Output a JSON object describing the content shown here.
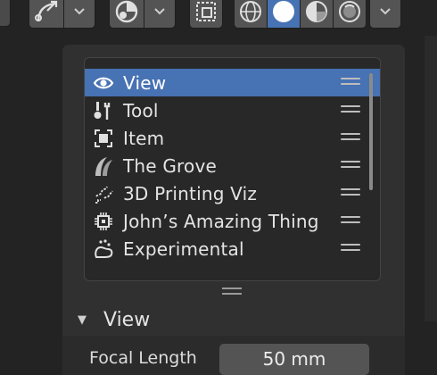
{
  "toolbar": {
    "buttons": [
      {
        "name": "curve-tool-icon"
      },
      {
        "name": "overlay-toggle-icon"
      },
      {
        "name": "xray-icon"
      },
      {
        "name": "wireframe-shading-icon"
      },
      {
        "name": "solid-shading-icon",
        "active": true
      },
      {
        "name": "material-preview-icon"
      },
      {
        "name": "rendered-shading-icon"
      }
    ]
  },
  "tabs_list": {
    "items": [
      {
        "label": "View",
        "icon": "eye-icon",
        "selected": true
      },
      {
        "label": "Tool",
        "icon": "tool-icon"
      },
      {
        "label": "Item",
        "icon": "item-icon"
      },
      {
        "label": "The Grove",
        "icon": "grove-icon"
      },
      {
        "label": "3D Printing Viz",
        "icon": "printing-icon"
      },
      {
        "label": "John’s Amazing Thing",
        "icon": "chip-icon"
      },
      {
        "label": "Experimental",
        "icon": "experimental-icon"
      }
    ]
  },
  "view_section": {
    "title": "View",
    "focal_length_label": "Focal Length",
    "focal_length_value": "50 mm"
  },
  "colors": {
    "accent": "#4772b3",
    "panel": "#303030",
    "background": "#232323"
  }
}
